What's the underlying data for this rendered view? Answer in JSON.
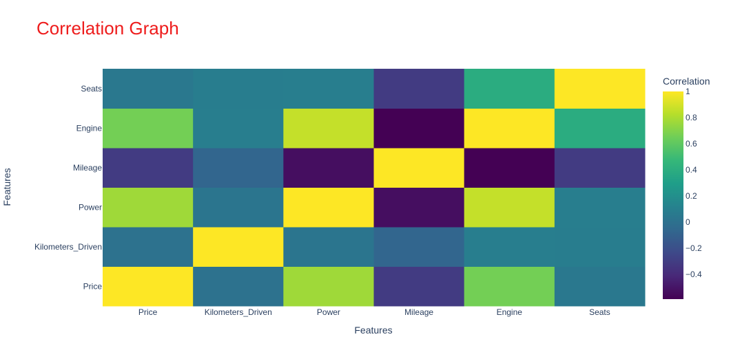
{
  "chart_data": {
    "type": "heatmap",
    "title": "Correlation Graph",
    "xlabel": "Features",
    "ylabel": "Features",
    "x": [
      "Price",
      "Kilometers_Driven",
      "Power",
      "Mileage",
      "Engine",
      "Seats"
    ],
    "y": [
      "Price",
      "Kilometers_Driven",
      "Power",
      "Mileage",
      "Engine",
      "Seats"
    ],
    "z": [
      [
        1.0,
        0.01,
        0.77,
        -0.31,
        0.66,
        0.05
      ],
      [
        0.01,
        1.0,
        0.03,
        -0.07,
        0.09,
        0.08
      ],
      [
        0.77,
        0.03,
        1.0,
        -0.53,
        0.86,
        0.09
      ],
      [
        -0.31,
        -0.07,
        -0.53,
        1.0,
        -0.59,
        -0.31
      ],
      [
        0.66,
        0.09,
        0.86,
        -0.59,
        1.0,
        0.39
      ],
      [
        0.05,
        0.08,
        0.09,
        -0.31,
        0.39,
        1.0
      ]
    ],
    "colorscale": "Viridis",
    "zmin": -0.59,
    "zmax": 1.0,
    "colorbar": {
      "title": "Correlation",
      "ticks": [
        "1",
        "0.8",
        "0.6",
        "0.4",
        "0.2",
        "0",
        "−0.2",
        "−0.4"
      ],
      "tick_values": [
        1,
        0.8,
        0.6,
        0.4,
        0.2,
        0,
        -0.2,
        -0.4
      ]
    }
  }
}
